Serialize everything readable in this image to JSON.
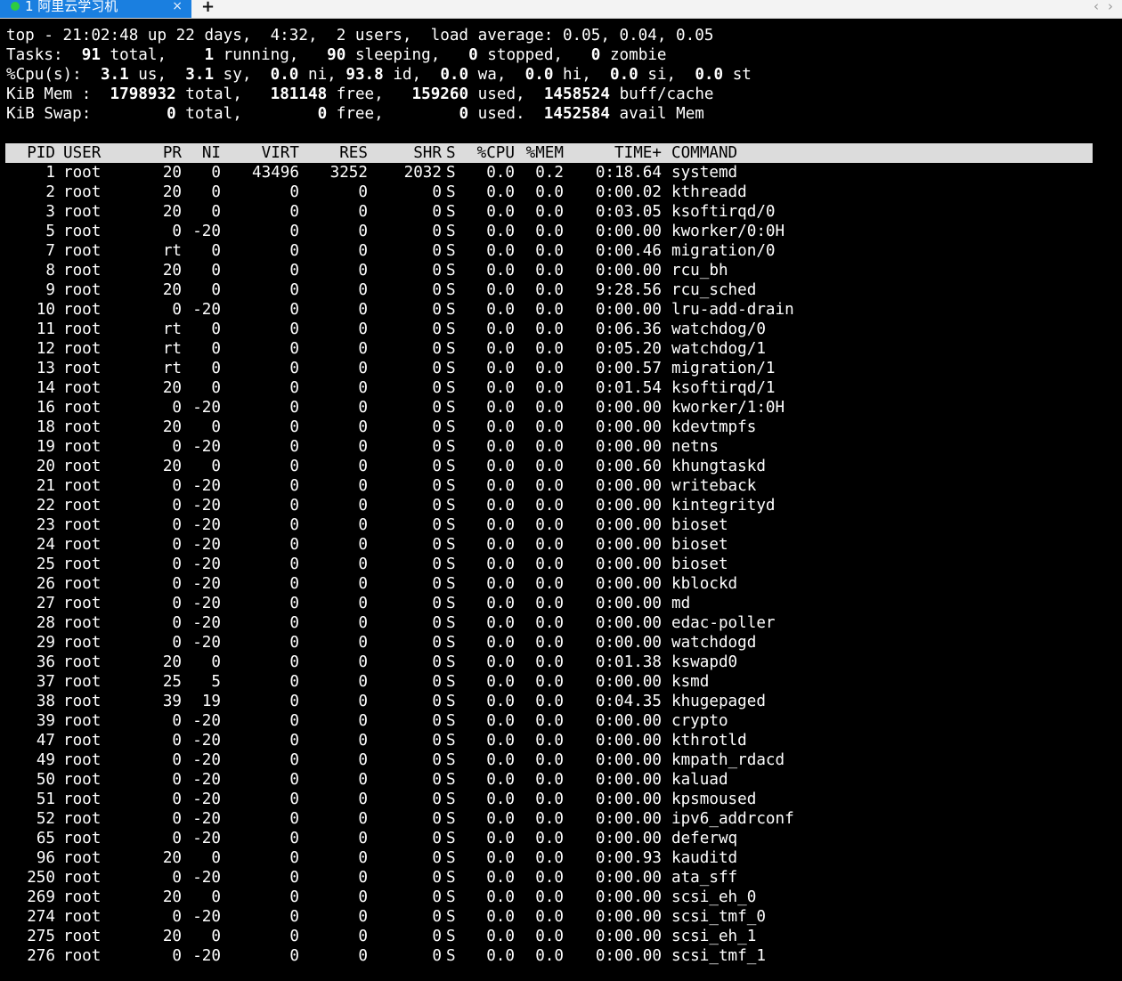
{
  "tab": {
    "title": "1 阿里云学习机",
    "close": "×",
    "new_tab": "+",
    "scroll_left": "‹",
    "scroll_right": "›",
    "status_color": "#2ecc40",
    "accent_color": "#1a7fe0"
  },
  "summary": {
    "top": "top - 21:02:48 up 22 days,  4:32,  2 users,  load average: 0.05, 0.04, 0.05",
    "tasks": {
      "label": "Tasks: ",
      "total": " 91",
      "total_label": " total,   ",
      "running": " 1",
      "running_label": " running,  ",
      "sleeping": " 90",
      "sleeping_label": " sleeping,   ",
      "stopped": "0",
      "stopped_label": " stopped,   ",
      "zombie": "0",
      "zombie_label": " zombie"
    },
    "cpu": {
      "label": "%Cpu(s):  ",
      "us": "3.1",
      "us_label": " us,  ",
      "sy": "3.1",
      "sy_label": " sy,  ",
      "ni": "0.0",
      "ni_label": " ni, ",
      "id": "93.8",
      "id_label": " id,  ",
      "wa": "0.0",
      "wa_label": " wa,  ",
      "hi": "0.0",
      "hi_label": " hi,  ",
      "si": "0.0",
      "si_label": " si,  ",
      "st": "0.0",
      "st_label": " st"
    },
    "mem": {
      "label": "KiB Mem :  ",
      "total": "1798932",
      "total_label": " total,   ",
      "free": "181148",
      "free_label": " free,   ",
      "used": "159260",
      "used_label": " used,  ",
      "buff": "1458524",
      "buff_label": " buff/cache"
    },
    "swap": {
      "label": "KiB Swap:        ",
      "total": "0",
      "total_label": " total,        ",
      "free": "0",
      "free_label": " free,        ",
      "used": "0",
      "used_label": " used.  ",
      "avail": "1452584",
      "avail_label": " avail Mem"
    }
  },
  "table": {
    "columns": {
      "pid": "PID",
      "user": "USER",
      "pr": "PR",
      "ni": "NI",
      "virt": "VIRT",
      "res": "RES",
      "shr": "SHR",
      "s": "S",
      "cpu": "%CPU",
      "mem": "%MEM",
      "time": "TIME+",
      "command": "COMMAND"
    },
    "rows": [
      {
        "pid": "1",
        "user": "root",
        "pr": "20",
        "ni": "0",
        "virt": "43496",
        "res": "3252",
        "shr": "2032",
        "s": "S",
        "cpu": "0.0",
        "mem": "0.2",
        "time": "0:18.64",
        "command": "systemd"
      },
      {
        "pid": "2",
        "user": "root",
        "pr": "20",
        "ni": "0",
        "virt": "0",
        "res": "0",
        "shr": "0",
        "s": "S",
        "cpu": "0.0",
        "mem": "0.0",
        "time": "0:00.02",
        "command": "kthreadd"
      },
      {
        "pid": "3",
        "user": "root",
        "pr": "20",
        "ni": "0",
        "virt": "0",
        "res": "0",
        "shr": "0",
        "s": "S",
        "cpu": "0.0",
        "mem": "0.0",
        "time": "0:03.05",
        "command": "ksoftirqd/0"
      },
      {
        "pid": "5",
        "user": "root",
        "pr": "0",
        "ni": "-20",
        "virt": "0",
        "res": "0",
        "shr": "0",
        "s": "S",
        "cpu": "0.0",
        "mem": "0.0",
        "time": "0:00.00",
        "command": "kworker/0:0H"
      },
      {
        "pid": "7",
        "user": "root",
        "pr": "rt",
        "ni": "0",
        "virt": "0",
        "res": "0",
        "shr": "0",
        "s": "S",
        "cpu": "0.0",
        "mem": "0.0",
        "time": "0:00.46",
        "command": "migration/0"
      },
      {
        "pid": "8",
        "user": "root",
        "pr": "20",
        "ni": "0",
        "virt": "0",
        "res": "0",
        "shr": "0",
        "s": "S",
        "cpu": "0.0",
        "mem": "0.0",
        "time": "0:00.00",
        "command": "rcu_bh"
      },
      {
        "pid": "9",
        "user": "root",
        "pr": "20",
        "ni": "0",
        "virt": "0",
        "res": "0",
        "shr": "0",
        "s": "S",
        "cpu": "0.0",
        "mem": "0.0",
        "time": "9:28.56",
        "command": "rcu_sched"
      },
      {
        "pid": "10",
        "user": "root",
        "pr": "0",
        "ni": "-20",
        "virt": "0",
        "res": "0",
        "shr": "0",
        "s": "S",
        "cpu": "0.0",
        "mem": "0.0",
        "time": "0:00.00",
        "command": "lru-add-drain"
      },
      {
        "pid": "11",
        "user": "root",
        "pr": "rt",
        "ni": "0",
        "virt": "0",
        "res": "0",
        "shr": "0",
        "s": "S",
        "cpu": "0.0",
        "mem": "0.0",
        "time": "0:06.36",
        "command": "watchdog/0"
      },
      {
        "pid": "12",
        "user": "root",
        "pr": "rt",
        "ni": "0",
        "virt": "0",
        "res": "0",
        "shr": "0",
        "s": "S",
        "cpu": "0.0",
        "mem": "0.0",
        "time": "0:05.20",
        "command": "watchdog/1"
      },
      {
        "pid": "13",
        "user": "root",
        "pr": "rt",
        "ni": "0",
        "virt": "0",
        "res": "0",
        "shr": "0",
        "s": "S",
        "cpu": "0.0",
        "mem": "0.0",
        "time": "0:00.57",
        "command": "migration/1"
      },
      {
        "pid": "14",
        "user": "root",
        "pr": "20",
        "ni": "0",
        "virt": "0",
        "res": "0",
        "shr": "0",
        "s": "S",
        "cpu": "0.0",
        "mem": "0.0",
        "time": "0:01.54",
        "command": "ksoftirqd/1"
      },
      {
        "pid": "16",
        "user": "root",
        "pr": "0",
        "ni": "-20",
        "virt": "0",
        "res": "0",
        "shr": "0",
        "s": "S",
        "cpu": "0.0",
        "mem": "0.0",
        "time": "0:00.00",
        "command": "kworker/1:0H"
      },
      {
        "pid": "18",
        "user": "root",
        "pr": "20",
        "ni": "0",
        "virt": "0",
        "res": "0",
        "shr": "0",
        "s": "S",
        "cpu": "0.0",
        "mem": "0.0",
        "time": "0:00.00",
        "command": "kdevtmpfs"
      },
      {
        "pid": "19",
        "user": "root",
        "pr": "0",
        "ni": "-20",
        "virt": "0",
        "res": "0",
        "shr": "0",
        "s": "S",
        "cpu": "0.0",
        "mem": "0.0",
        "time": "0:00.00",
        "command": "netns"
      },
      {
        "pid": "20",
        "user": "root",
        "pr": "20",
        "ni": "0",
        "virt": "0",
        "res": "0",
        "shr": "0",
        "s": "S",
        "cpu": "0.0",
        "mem": "0.0",
        "time": "0:00.60",
        "command": "khungtaskd"
      },
      {
        "pid": "21",
        "user": "root",
        "pr": "0",
        "ni": "-20",
        "virt": "0",
        "res": "0",
        "shr": "0",
        "s": "S",
        "cpu": "0.0",
        "mem": "0.0",
        "time": "0:00.00",
        "command": "writeback"
      },
      {
        "pid": "22",
        "user": "root",
        "pr": "0",
        "ni": "-20",
        "virt": "0",
        "res": "0",
        "shr": "0",
        "s": "S",
        "cpu": "0.0",
        "mem": "0.0",
        "time": "0:00.00",
        "command": "kintegrityd"
      },
      {
        "pid": "23",
        "user": "root",
        "pr": "0",
        "ni": "-20",
        "virt": "0",
        "res": "0",
        "shr": "0",
        "s": "S",
        "cpu": "0.0",
        "mem": "0.0",
        "time": "0:00.00",
        "command": "bioset"
      },
      {
        "pid": "24",
        "user": "root",
        "pr": "0",
        "ni": "-20",
        "virt": "0",
        "res": "0",
        "shr": "0",
        "s": "S",
        "cpu": "0.0",
        "mem": "0.0",
        "time": "0:00.00",
        "command": "bioset"
      },
      {
        "pid": "25",
        "user": "root",
        "pr": "0",
        "ni": "-20",
        "virt": "0",
        "res": "0",
        "shr": "0",
        "s": "S",
        "cpu": "0.0",
        "mem": "0.0",
        "time": "0:00.00",
        "command": "bioset"
      },
      {
        "pid": "26",
        "user": "root",
        "pr": "0",
        "ni": "-20",
        "virt": "0",
        "res": "0",
        "shr": "0",
        "s": "S",
        "cpu": "0.0",
        "mem": "0.0",
        "time": "0:00.00",
        "command": "kblockd"
      },
      {
        "pid": "27",
        "user": "root",
        "pr": "0",
        "ni": "-20",
        "virt": "0",
        "res": "0",
        "shr": "0",
        "s": "S",
        "cpu": "0.0",
        "mem": "0.0",
        "time": "0:00.00",
        "command": "md"
      },
      {
        "pid": "28",
        "user": "root",
        "pr": "0",
        "ni": "-20",
        "virt": "0",
        "res": "0",
        "shr": "0",
        "s": "S",
        "cpu": "0.0",
        "mem": "0.0",
        "time": "0:00.00",
        "command": "edac-poller"
      },
      {
        "pid": "29",
        "user": "root",
        "pr": "0",
        "ni": "-20",
        "virt": "0",
        "res": "0",
        "shr": "0",
        "s": "S",
        "cpu": "0.0",
        "mem": "0.0",
        "time": "0:00.00",
        "command": "watchdogd"
      },
      {
        "pid": "36",
        "user": "root",
        "pr": "20",
        "ni": "0",
        "virt": "0",
        "res": "0",
        "shr": "0",
        "s": "S",
        "cpu": "0.0",
        "mem": "0.0",
        "time": "0:01.38",
        "command": "kswapd0"
      },
      {
        "pid": "37",
        "user": "root",
        "pr": "25",
        "ni": "5",
        "virt": "0",
        "res": "0",
        "shr": "0",
        "s": "S",
        "cpu": "0.0",
        "mem": "0.0",
        "time": "0:00.00",
        "command": "ksmd"
      },
      {
        "pid": "38",
        "user": "root",
        "pr": "39",
        "ni": "19",
        "virt": "0",
        "res": "0",
        "shr": "0",
        "s": "S",
        "cpu": "0.0",
        "mem": "0.0",
        "time": "0:04.35",
        "command": "khugepaged"
      },
      {
        "pid": "39",
        "user": "root",
        "pr": "0",
        "ni": "-20",
        "virt": "0",
        "res": "0",
        "shr": "0",
        "s": "S",
        "cpu": "0.0",
        "mem": "0.0",
        "time": "0:00.00",
        "command": "crypto"
      },
      {
        "pid": "47",
        "user": "root",
        "pr": "0",
        "ni": "-20",
        "virt": "0",
        "res": "0",
        "shr": "0",
        "s": "S",
        "cpu": "0.0",
        "mem": "0.0",
        "time": "0:00.00",
        "command": "kthrotld"
      },
      {
        "pid": "49",
        "user": "root",
        "pr": "0",
        "ni": "-20",
        "virt": "0",
        "res": "0",
        "shr": "0",
        "s": "S",
        "cpu": "0.0",
        "mem": "0.0",
        "time": "0:00.00",
        "command": "kmpath_rdacd"
      },
      {
        "pid": "50",
        "user": "root",
        "pr": "0",
        "ni": "-20",
        "virt": "0",
        "res": "0",
        "shr": "0",
        "s": "S",
        "cpu": "0.0",
        "mem": "0.0",
        "time": "0:00.00",
        "command": "kaluad"
      },
      {
        "pid": "51",
        "user": "root",
        "pr": "0",
        "ni": "-20",
        "virt": "0",
        "res": "0",
        "shr": "0",
        "s": "S",
        "cpu": "0.0",
        "mem": "0.0",
        "time": "0:00.00",
        "command": "kpsmoused"
      },
      {
        "pid": "52",
        "user": "root",
        "pr": "0",
        "ni": "-20",
        "virt": "0",
        "res": "0",
        "shr": "0",
        "s": "S",
        "cpu": "0.0",
        "mem": "0.0",
        "time": "0:00.00",
        "command": "ipv6_addrconf"
      },
      {
        "pid": "65",
        "user": "root",
        "pr": "0",
        "ni": "-20",
        "virt": "0",
        "res": "0",
        "shr": "0",
        "s": "S",
        "cpu": "0.0",
        "mem": "0.0",
        "time": "0:00.00",
        "command": "deferwq"
      },
      {
        "pid": "96",
        "user": "root",
        "pr": "20",
        "ni": "0",
        "virt": "0",
        "res": "0",
        "shr": "0",
        "s": "S",
        "cpu": "0.0",
        "mem": "0.0",
        "time": "0:00.93",
        "command": "kauditd"
      },
      {
        "pid": "250",
        "user": "root",
        "pr": "0",
        "ni": "-20",
        "virt": "0",
        "res": "0",
        "shr": "0",
        "s": "S",
        "cpu": "0.0",
        "mem": "0.0",
        "time": "0:00.00",
        "command": "ata_sff"
      },
      {
        "pid": "269",
        "user": "root",
        "pr": "20",
        "ni": "0",
        "virt": "0",
        "res": "0",
        "shr": "0",
        "s": "S",
        "cpu": "0.0",
        "mem": "0.0",
        "time": "0:00.00",
        "command": "scsi_eh_0"
      },
      {
        "pid": "274",
        "user": "root",
        "pr": "0",
        "ni": "-20",
        "virt": "0",
        "res": "0",
        "shr": "0",
        "s": "S",
        "cpu": "0.0",
        "mem": "0.0",
        "time": "0:00.00",
        "command": "scsi_tmf_0"
      },
      {
        "pid": "275",
        "user": "root",
        "pr": "20",
        "ni": "0",
        "virt": "0",
        "res": "0",
        "shr": "0",
        "s": "S",
        "cpu": "0.0",
        "mem": "0.0",
        "time": "0:00.00",
        "command": "scsi_eh_1"
      },
      {
        "pid": "276",
        "user": "root",
        "pr": "0",
        "ni": "-20",
        "virt": "0",
        "res": "0",
        "shr": "0",
        "s": "S",
        "cpu": "0.0",
        "mem": "0.0",
        "time": "0:00.00",
        "command": "scsi_tmf_1"
      }
    ]
  }
}
